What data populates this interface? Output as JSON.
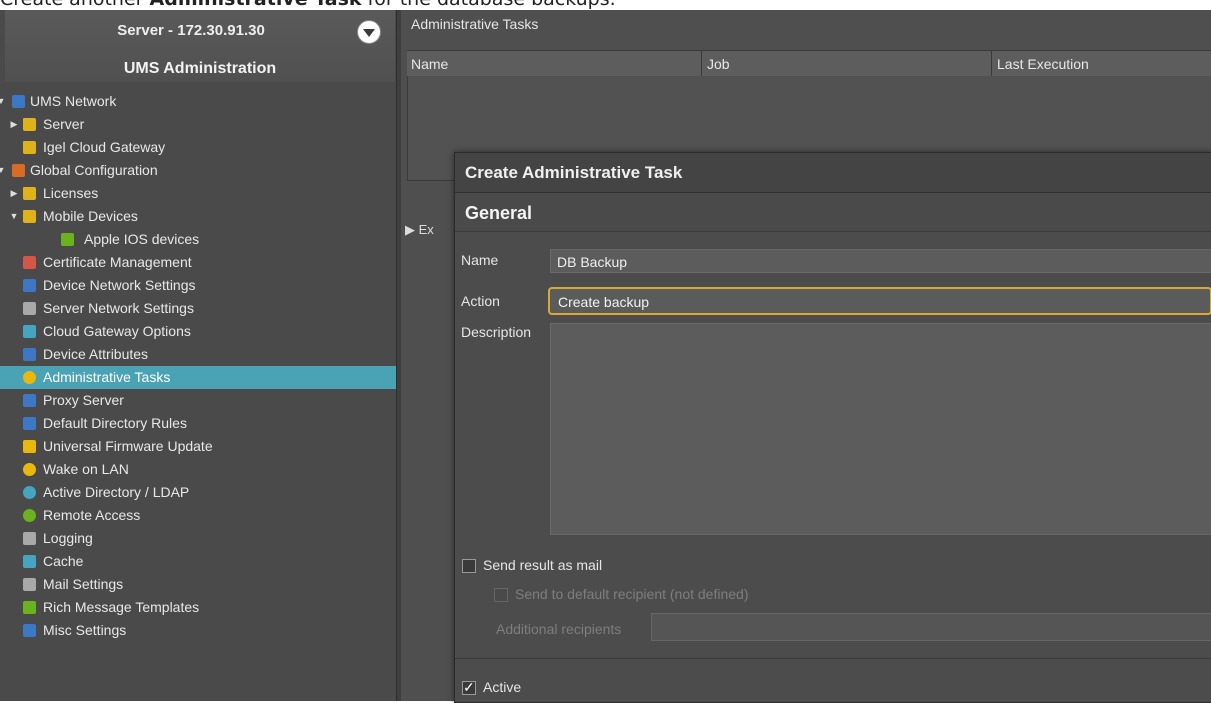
{
  "caption": {
    "prefix": "Create another ",
    "bold": "Administrative Task",
    "suffix": " for the database backups."
  },
  "left_panel": {
    "server_title": "Server - 172.30.91.30",
    "section_title": "UMS Administration"
  },
  "tree": {
    "items": [
      {
        "label": "UMS Network"
      },
      {
        "label": "Server"
      },
      {
        "label": "Igel Cloud Gateway"
      },
      {
        "label": "Global Configuration"
      },
      {
        "label": "Licenses"
      },
      {
        "label": "Mobile Devices"
      },
      {
        "label": "Apple IOS devices"
      },
      {
        "label": "Certificate Management"
      },
      {
        "label": "Device Network Settings"
      },
      {
        "label": "Server Network Settings"
      },
      {
        "label": "Cloud Gateway Options"
      },
      {
        "label": "Device Attributes"
      },
      {
        "label": "Administrative Tasks"
      },
      {
        "label": "Proxy Server"
      },
      {
        "label": "Default Directory Rules"
      },
      {
        "label": "Universal Firmware Update"
      },
      {
        "label": "Wake on LAN"
      },
      {
        "label": "Active Directory / LDAP"
      },
      {
        "label": "Remote Access"
      },
      {
        "label": "Logging"
      },
      {
        "label": "Cache"
      },
      {
        "label": "Mail Settings"
      },
      {
        "label": "Rich Message Templates"
      },
      {
        "label": "Misc Settings"
      }
    ]
  },
  "main": {
    "header": "Administrative Tasks",
    "columns": [
      "Name",
      "Job",
      "Last Execution"
    ],
    "expand_label": "Ex"
  },
  "dialog": {
    "title": "Create Administrative Task",
    "section": "General",
    "name_label": "Name",
    "name_value": "DB Backup",
    "action_label": "Action",
    "action_value": "Create backup",
    "description_label": "Description",
    "send_mail_label": "Send result as mail",
    "send_default_label": "Send to default recipient (not defined)",
    "additional_recipients_label": "Additional recipients",
    "active_label": "Active",
    "send_mail_checked": false,
    "active_checked": true
  }
}
